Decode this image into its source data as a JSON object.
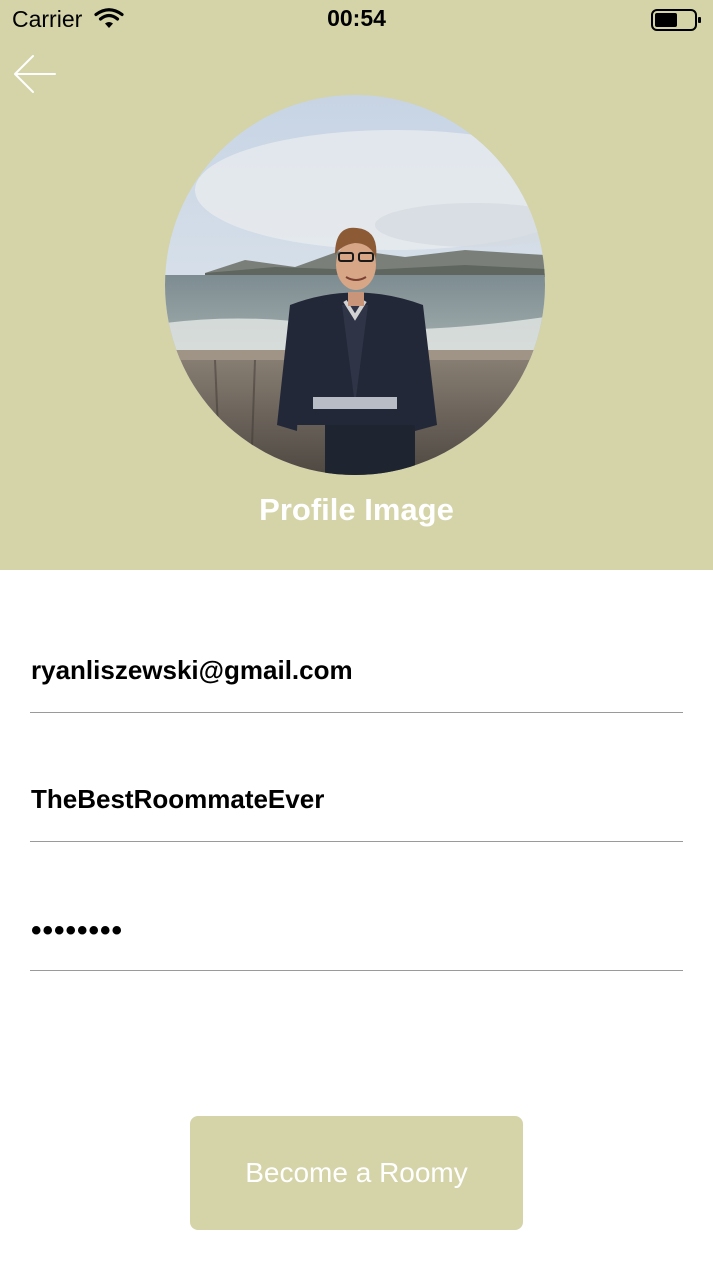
{
  "status_bar": {
    "carrier": "Carrier",
    "time": "00:54",
    "icons": [
      "wifi-icon",
      "battery-icon"
    ]
  },
  "header": {
    "back_icon": "arrow-left-icon",
    "profile_label": "Profile Image",
    "background_color": "#d4d4a8"
  },
  "form": {
    "email_value": "ryanliszewski@gmail.com",
    "username_value": "TheBestRoommateEver",
    "password_value": "••••••••"
  },
  "cta": {
    "label": "Become a Roomy",
    "color": "#d4d4a8"
  }
}
